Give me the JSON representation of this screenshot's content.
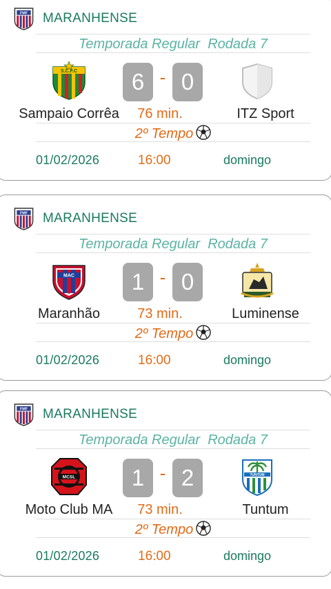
{
  "colors": {
    "competition": "#1a7a5f",
    "season": "#5bb3a3",
    "accent": "#e06b17",
    "score_box": "#a8a8a8"
  },
  "matches": [
    {
      "competition": "MARANHENSE",
      "season_label": "Temporada Regular  Rodada 7",
      "home_team": "Sampaio Corrêa",
      "away_team": "ITZ Sport",
      "home_score": "6",
      "away_score": "0",
      "separator": "-",
      "minute": "76 min.",
      "period": "2º Tempo",
      "date": "01/02/2026",
      "time": "16:00",
      "weekday": "domingo",
      "home_icon": "sampaio-correa-crest-icon",
      "away_icon": "blank-shield-icon"
    },
    {
      "competition": "MARANHENSE",
      "season_label": "Temporada Regular  Rodada 7",
      "home_team": "Maranhão",
      "away_team": "Luminense",
      "home_score": "1",
      "away_score": "0",
      "separator": "-",
      "minute": "73 min.",
      "period": "2º Tempo",
      "date": "01/02/2026",
      "time": "16:00",
      "weekday": "domingo",
      "home_icon": "maranhao-crest-icon",
      "away_icon": "luminense-crest-icon"
    },
    {
      "competition": "MARANHENSE",
      "season_label": "Temporada Regular  Rodada 7",
      "home_team": "Moto Club MA",
      "away_team": "Tuntum",
      "home_score": "1",
      "away_score": "2",
      "separator": "-",
      "minute": "73 min.",
      "period": "2º Tempo",
      "date": "01/02/2026",
      "time": "16:00",
      "weekday": "domingo",
      "home_icon": "moto-club-crest-icon",
      "away_icon": "tuntum-crest-icon"
    }
  ]
}
